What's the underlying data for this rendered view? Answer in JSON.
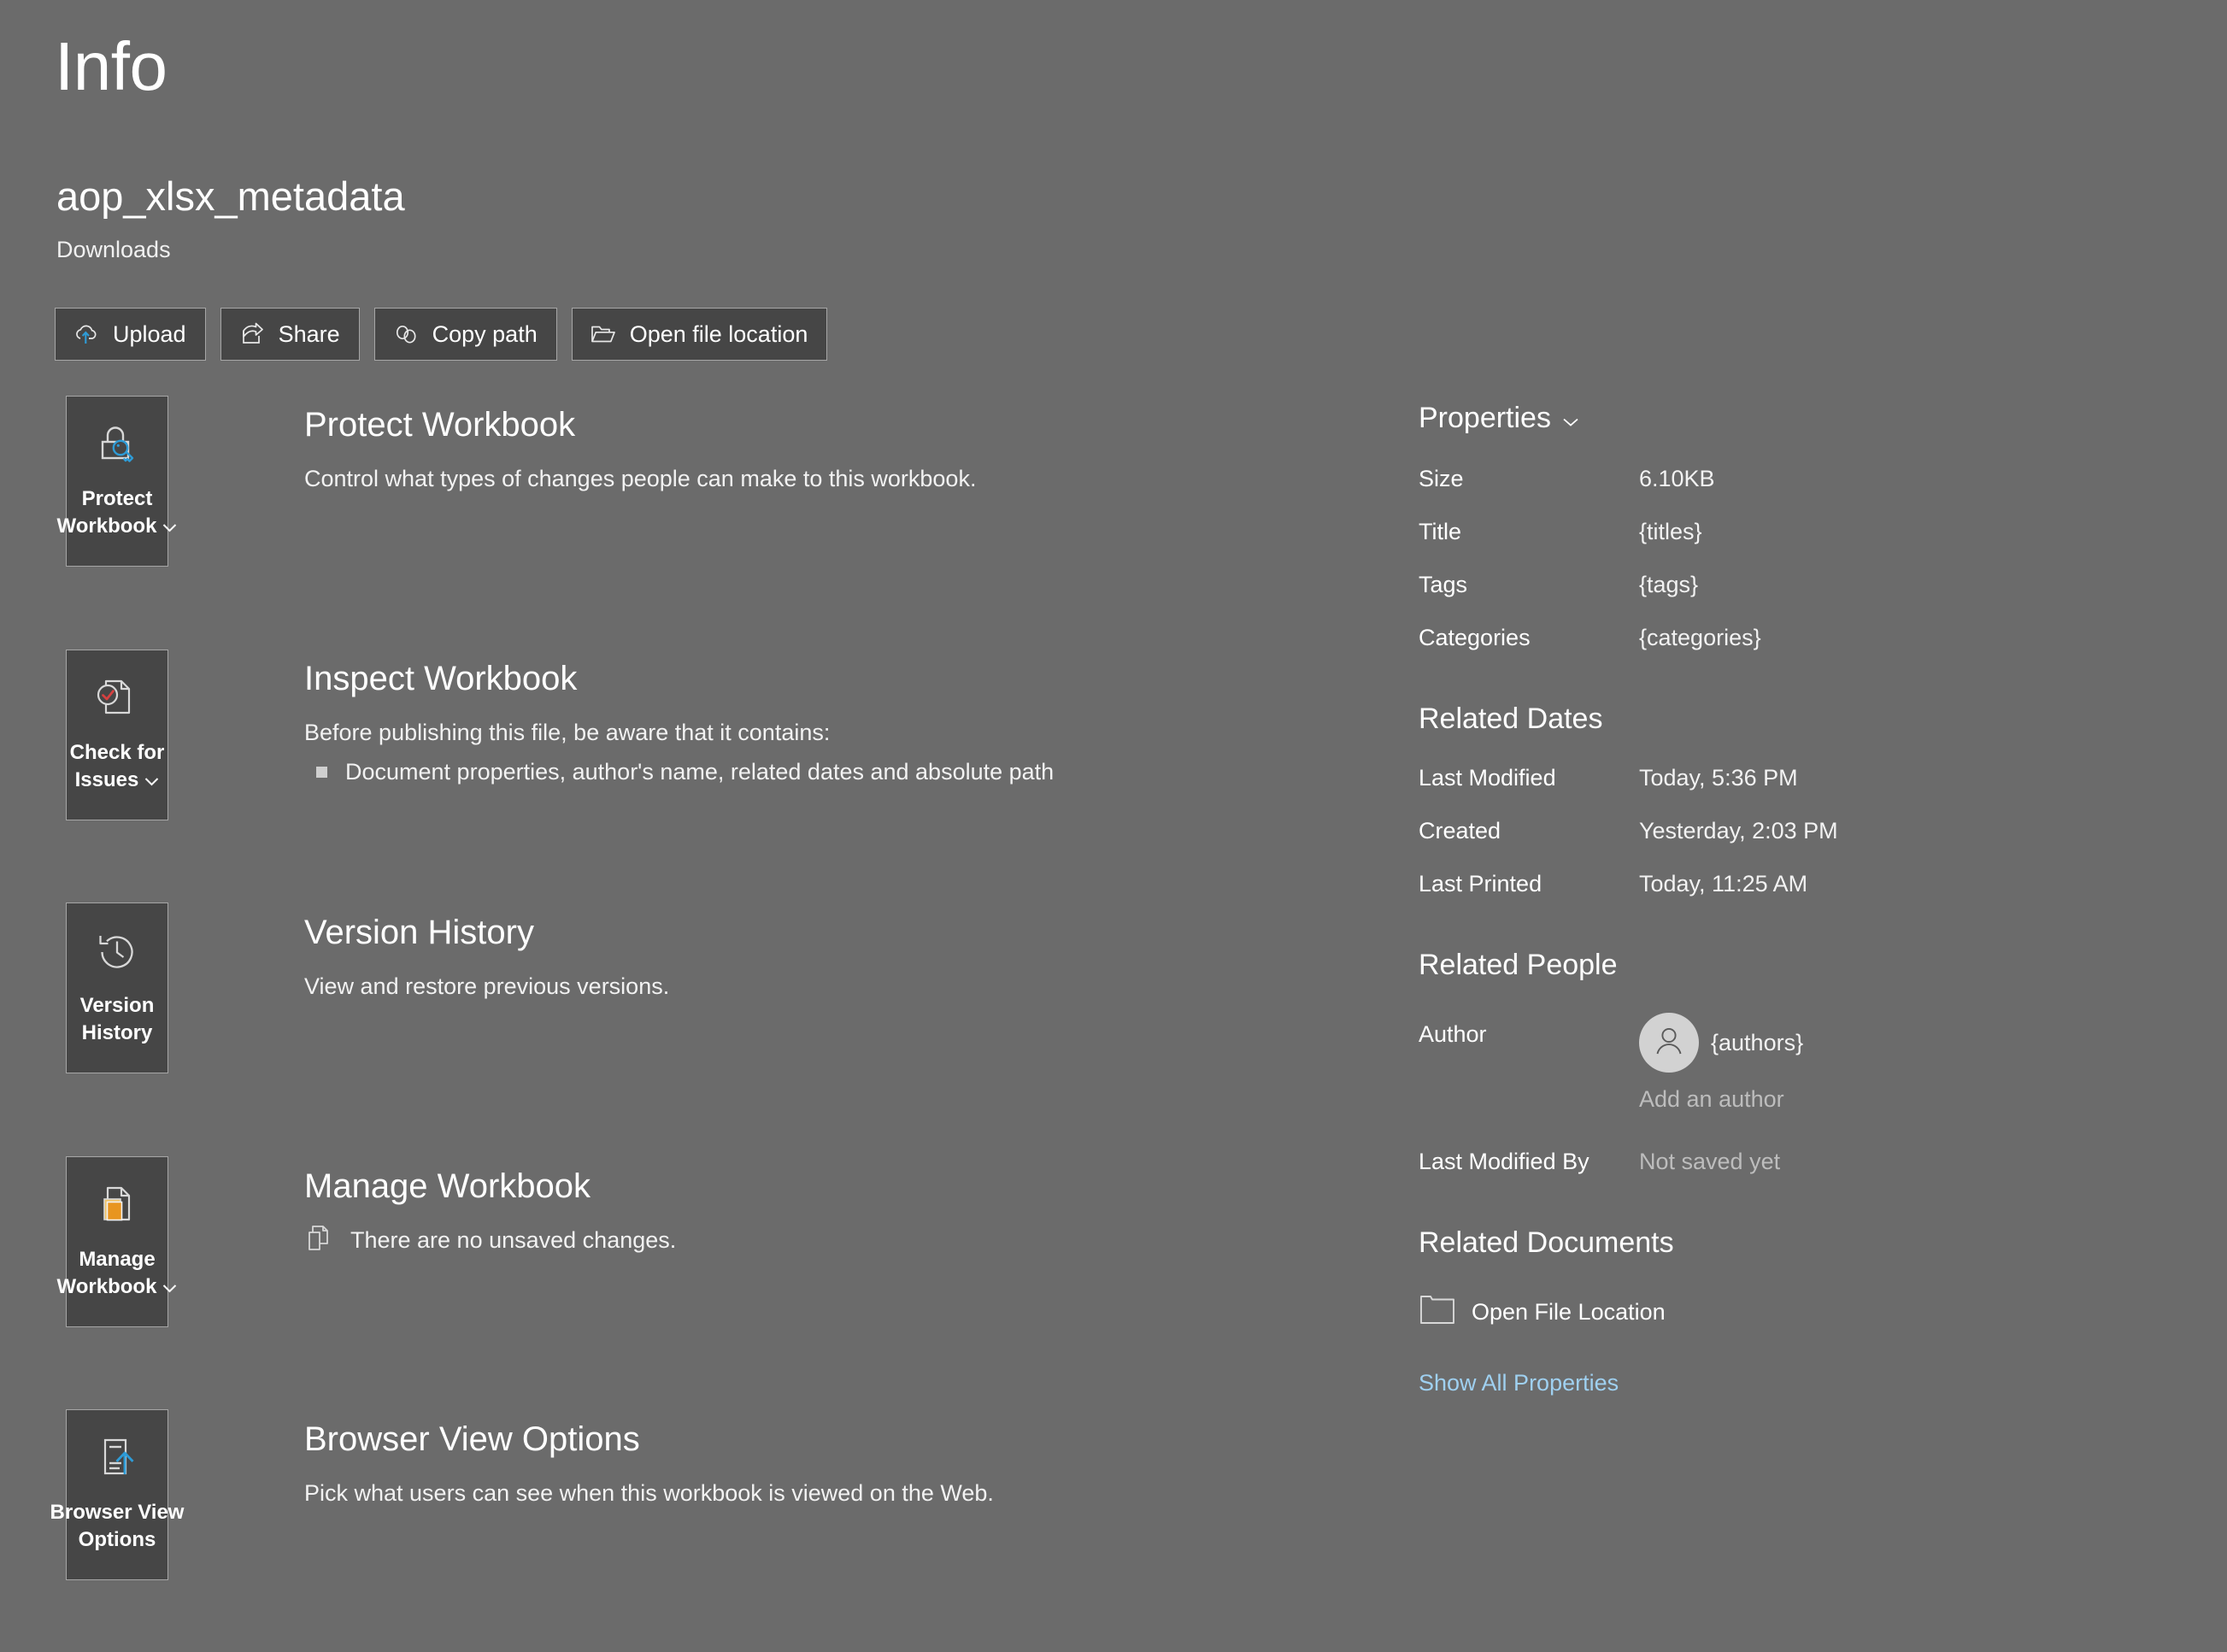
{
  "header": {
    "page_title": "Info",
    "file_name": "aop_xlsx_metadata",
    "file_path": "Downloads"
  },
  "action_buttons": [
    {
      "label": "Upload",
      "icon": "cloud-upload-icon"
    },
    {
      "label": "Share",
      "icon": "share-icon"
    },
    {
      "label": "Copy path",
      "icon": "link-icon"
    },
    {
      "label": "Open file location",
      "icon": "folder-open-icon"
    }
  ],
  "sections": [
    {
      "tile_line1": "Protect",
      "tile_line2": "Workbook",
      "tile_has_chevron": true,
      "tile_icon": "lock-key-icon",
      "heading": "Protect Workbook",
      "description": "Control what types of changes people can make to this workbook."
    },
    {
      "tile_line1": "Check for",
      "tile_line2": "Issues",
      "tile_has_chevron": true,
      "tile_icon": "document-check-icon",
      "heading": "Inspect Workbook",
      "description": "Before publishing this file, be aware that it contains:",
      "bullet": "Document properties, author's name, related dates and absolute path"
    },
    {
      "tile_line1": "Version",
      "tile_line2": "History",
      "tile_has_chevron": false,
      "tile_icon": "clock-history-icon",
      "heading": "Version History",
      "description": "View and restore previous versions."
    },
    {
      "tile_line1": "Manage",
      "tile_line2": "Workbook",
      "tile_has_chevron": true,
      "tile_icon": "document-versions-icon",
      "heading": "Manage Workbook",
      "note": "There are no unsaved changes.",
      "note_icon": "copy-document-icon"
    },
    {
      "tile_line1": "Browser View",
      "tile_line2": "Options",
      "tile_has_chevron": false,
      "tile_icon": "document-upload-icon",
      "heading": "Browser View Options",
      "description": "Pick what users can see when this workbook is viewed on the Web."
    }
  ],
  "properties": {
    "group_title": "Properties",
    "group_chevron_icon": "chevron-down-icon",
    "rows": [
      {
        "label": "Size",
        "value": "6.10KB"
      },
      {
        "label": "Title",
        "value": "{titles}"
      },
      {
        "label": "Tags",
        "value": "{tags}"
      },
      {
        "label": "Categories",
        "value": "{categories}"
      }
    ]
  },
  "related_dates": {
    "group_title": "Related Dates",
    "rows": [
      {
        "label": "Last Modified",
        "value": "Today, 5:36 PM"
      },
      {
        "label": "Created",
        "value": "Yesterday, 2:03 PM"
      },
      {
        "label": "Last Printed",
        "value": "Today, 11:25 AM"
      }
    ]
  },
  "related_people": {
    "group_title": "Related People",
    "author_label": "Author",
    "author_name": "{authors}",
    "author_avatar_icon": "person-icon",
    "add_author_label": "Add an author",
    "last_modified_by_label": "Last Modified By",
    "last_modified_by_value": "Not saved yet"
  },
  "related_documents": {
    "group_title": "Related Documents",
    "open_location_label": "Open File Location",
    "open_location_icon": "folder-icon",
    "show_all_properties_label": "Show All Properties"
  },
  "colors": {
    "background": "#6b6b6b",
    "tile_background": "#464646",
    "tile_border": "#a6a6a6",
    "accent_blue": "#2e9bd6",
    "accent_red": "#d64040",
    "accent_orange": "#e8a12c",
    "link_blue": "#9fd0f0"
  }
}
